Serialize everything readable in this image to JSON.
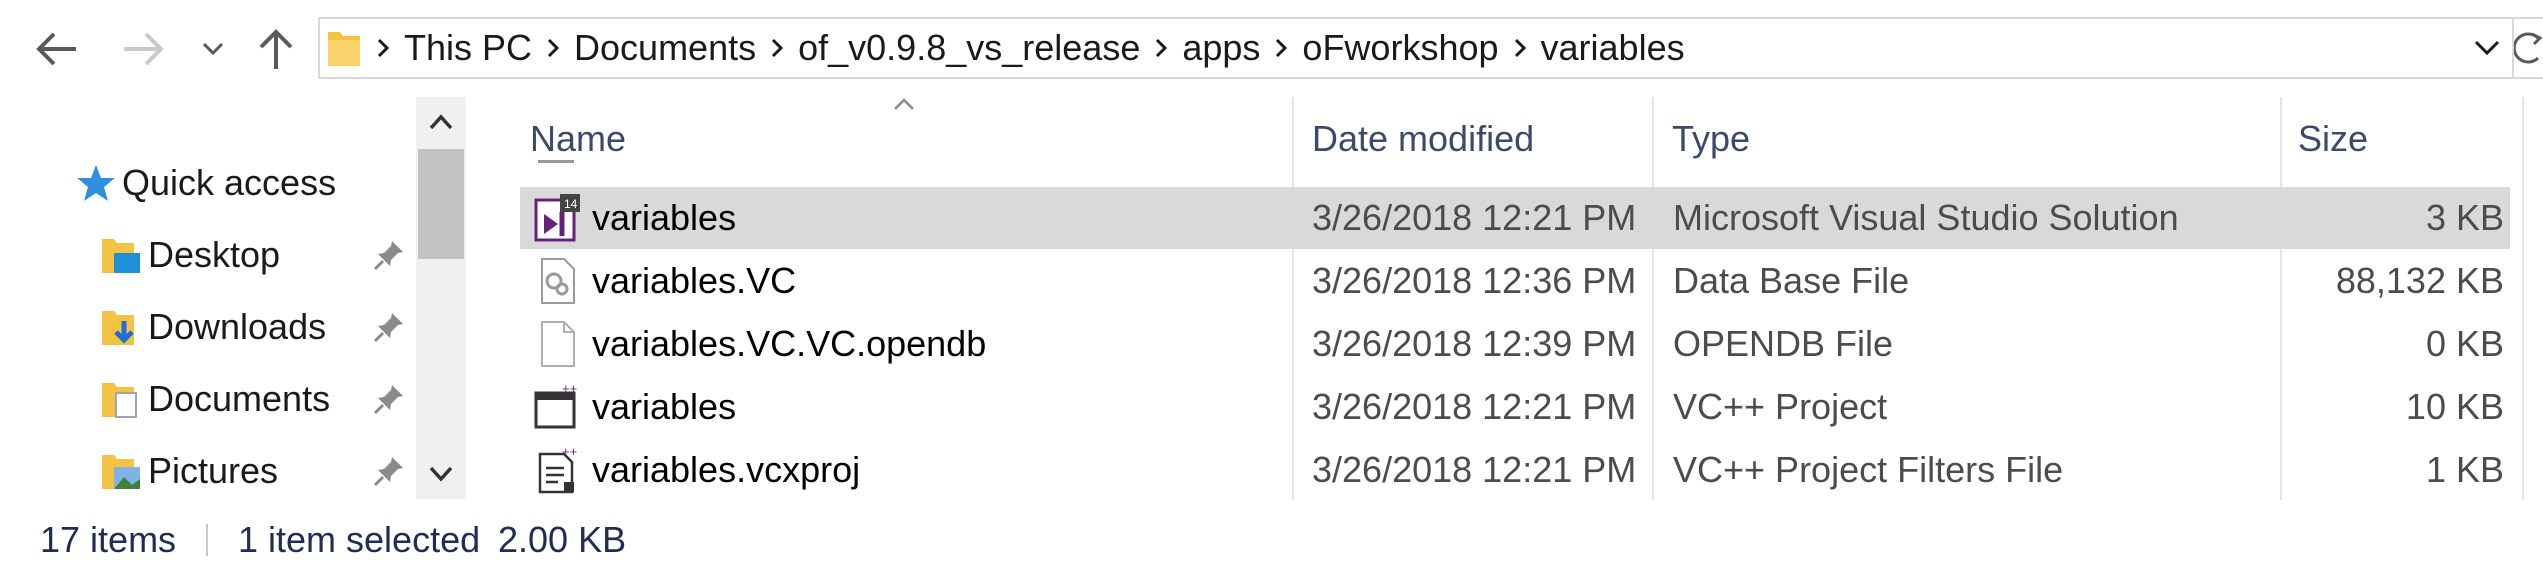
{
  "address_bar": {
    "path": [
      "This PC",
      "Documents",
      "of_v0.9.8_vs_release",
      "apps",
      "oFworkshop",
      "variables"
    ]
  },
  "nav_pane": {
    "quick_access": "Quick access",
    "items": [
      {
        "label": "Desktop",
        "icon": "desktop-folder-icon"
      },
      {
        "label": "Downloads",
        "icon": "downloads-folder-icon"
      },
      {
        "label": "Documents",
        "icon": "documents-folder-icon"
      },
      {
        "label": "Pictures",
        "icon": "pictures-folder-icon"
      }
    ]
  },
  "columns": {
    "name": "Name",
    "date": "Date modified",
    "type": "Type",
    "size": "Size"
  },
  "files": [
    {
      "name": "variables",
      "date": "3/26/2018 12:21 PM",
      "type": "Microsoft Visual Studio Solution",
      "size": "3 KB",
      "icon": "vs-solution-icon",
      "selected": true
    },
    {
      "name": "variables.VC",
      "date": "3/26/2018 12:36 PM",
      "type": "Data Base File",
      "size": "88,132 KB",
      "icon": "database-file-icon",
      "selected": false
    },
    {
      "name": "variables.VC.VC.opendb",
      "date": "3/26/2018 12:39 PM",
      "type": "OPENDB File",
      "size": "0 KB",
      "icon": "blank-file-icon",
      "selected": false
    },
    {
      "name": "variables",
      "date": "3/26/2018 12:21 PM",
      "type": "VC++ Project",
      "size": "10 KB",
      "icon": "vc-project-icon",
      "selected": false
    },
    {
      "name": "variables.vcxproj",
      "date": "3/26/2018 12:21 PM",
      "type": "VC++ Project Filters File",
      "size": "1 KB",
      "icon": "vc-filters-icon",
      "selected": false
    }
  ],
  "status": {
    "item_count": "17 items",
    "selection": "1 item selected",
    "selection_size": "2.00 KB"
  },
  "colors": {
    "selected_row": "#d9d9d9",
    "folder": "#f5c342",
    "vs_purple": "#68217a",
    "status_text": "#1f2d55"
  }
}
